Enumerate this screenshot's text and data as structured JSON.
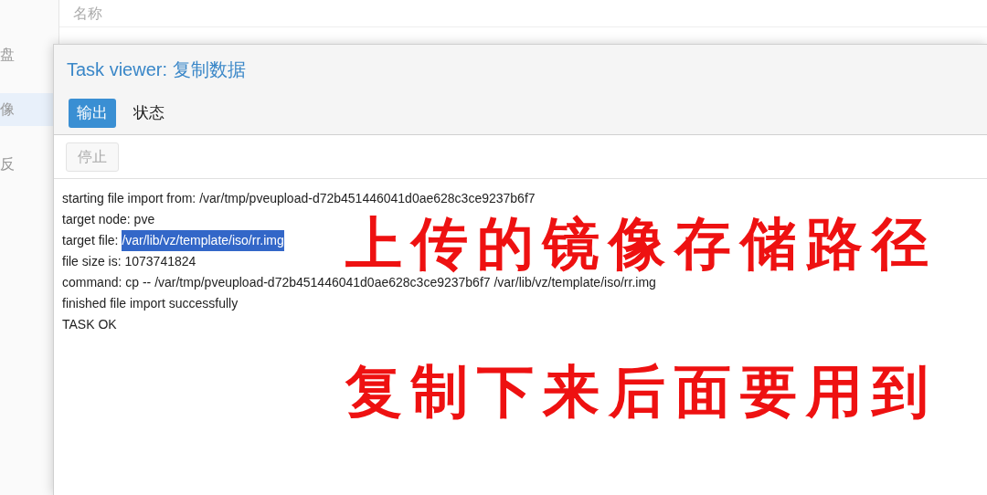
{
  "sidebar": {
    "items": [
      {
        "label": "盘",
        "selected": false
      },
      {
        "label": "像",
        "selected": true
      },
      {
        "label": "反",
        "selected": false
      }
    ]
  },
  "background_table": {
    "columns": [
      "名称"
    ]
  },
  "dialog": {
    "title_prefix": "Task viewer: ",
    "title": "复制数据",
    "tabs": [
      {
        "label": "输出",
        "selected": true
      },
      {
        "label": "状态",
        "selected": false
      }
    ],
    "toolbar": [
      {
        "label": "停止",
        "disabled": true
      }
    ],
    "log": [
      {
        "text": "starting file import from: /var/tmp/pveupload-d72b451446041d0ae628c3ce9237b6f7"
      },
      {
        "text": "target node: pve"
      },
      {
        "text": "target file: ",
        "selected_text": "/var/lib/vz/template/iso/rr.img"
      },
      {
        "text": "file size is: 1073741824"
      },
      {
        "text": "command: cp -- /var/tmp/pveupload-d72b451446041d0ae628c3ce9237b6f7 /var/lib/vz/template/iso/rr.img"
      },
      {
        "text": "finished file import successfully"
      },
      {
        "text": "TASK OK"
      }
    ]
  },
  "annotations": [
    "上传的镜像存储路径",
    "复制下来后面要用到"
  ]
}
